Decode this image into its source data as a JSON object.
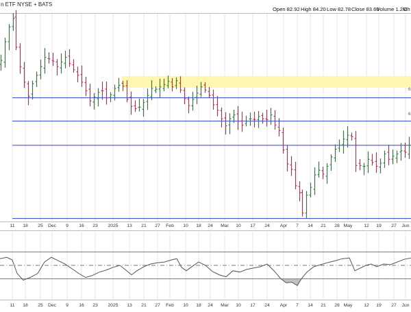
{
  "header": {
    "symbol_fragment": "n ETF  NYSE + BATS",
    "open": "Open 82.92",
    "high": "High 84.20",
    "low": "Low 82.78",
    "close": "Close 83.60",
    "volume": "Volume 1.2M",
    "overflow_fragment": "Ch"
  },
  "right_edge_labels": [
    "6",
    "6"
  ],
  "colors": {
    "up": "#1a8a2e",
    "down": "#d81b60",
    "hline": "#2b43c9",
    "zone": "#fff6b0",
    "indicator": "#555555",
    "grid": "#e4e4e4"
  },
  "chart_data": [
    {
      "type": "ohlc",
      "title": "",
      "x_tick_labels": [
        "11",
        "18",
        "25",
        "Dec",
        "9",
        "16",
        "23",
        "2025",
        "13",
        "21",
        "27",
        "Feb",
        "10",
        "18",
        "24",
        "Mar",
        "10",
        "17",
        "24",
        "Apr",
        "7",
        "14",
        "21",
        "28",
        "May",
        "12",
        "19",
        "27",
        "Jun"
      ],
      "horizontal_lines": [
        94.0,
        91.0,
        87.9,
        78.5
      ],
      "resistance_zone": [
        95.3,
        96.8
      ],
      "price_series": [
        {
          "x": 0,
          "close": 98.8
        },
        {
          "x": 6,
          "close": 101.2
        },
        {
          "x": 12,
          "close": 103.1
        },
        {
          "x": 18,
          "close": 104.2
        },
        {
          "x": 22,
          "close": 100.5
        },
        {
          "x": 28,
          "close": 98.0
        },
        {
          "x": 34,
          "close": 96.0
        },
        {
          "x": 40,
          "close": 94.2
        },
        {
          "x": 46,
          "close": 95.8
        },
        {
          "x": 52,
          "close": 96.9
        },
        {
          "x": 58,
          "close": 98.0
        },
        {
          "x": 64,
          "close": 99.2
        },
        {
          "x": 70,
          "close": 99.0
        },
        {
          "x": 76,
          "close": 98.7
        },
        {
          "x": 82,
          "close": 98.0
        },
        {
          "x": 88,
          "close": 98.6
        },
        {
          "x": 94,
          "close": 99.2
        },
        {
          "x": 100,
          "close": 98.4
        },
        {
          "x": 106,
          "close": 97.6
        },
        {
          "x": 112,
          "close": 96.9
        },
        {
          "x": 118,
          "close": 96.0
        },
        {
          "x": 124,
          "close": 94.9
        },
        {
          "x": 130,
          "close": 93.6
        },
        {
          "x": 136,
          "close": 94.1
        },
        {
          "x": 142,
          "close": 94.7
        },
        {
          "x": 148,
          "close": 94.9
        },
        {
          "x": 154,
          "close": 94.0
        },
        {
          "x": 160,
          "close": 94.4
        },
        {
          "x": 166,
          "close": 95.2
        },
        {
          "x": 172,
          "close": 95.6
        },
        {
          "x": 178,
          "close": 95.5
        },
        {
          "x": 184,
          "close": 93.8
        },
        {
          "x": 190,
          "close": 92.9
        },
        {
          "x": 196,
          "close": 92.6
        },
        {
          "x": 202,
          "close": 92.8
        },
        {
          "x": 208,
          "close": 93.4
        },
        {
          "x": 214,
          "close": 94.3
        },
        {
          "x": 220,
          "close": 95.2
        },
        {
          "x": 226,
          "close": 95.1
        },
        {
          "x": 232,
          "close": 95.4
        },
        {
          "x": 238,
          "close": 95.7
        },
        {
          "x": 244,
          "close": 96.1
        },
        {
          "x": 250,
          "close": 95.4
        },
        {
          "x": 256,
          "close": 96.2
        },
        {
          "x": 262,
          "close": 95.0
        },
        {
          "x": 268,
          "close": 93.9
        },
        {
          "x": 274,
          "close": 93.0
        },
        {
          "x": 280,
          "close": 93.8
        },
        {
          "x": 286,
          "close": 94.6
        },
        {
          "x": 292,
          "close": 95.4
        },
        {
          "x": 298,
          "close": 95.0
        },
        {
          "x": 304,
          "close": 94.3
        },
        {
          "x": 310,
          "close": 93.1
        },
        {
          "x": 316,
          "close": 92.4
        },
        {
          "x": 322,
          "close": 91.3
        },
        {
          "x": 328,
          "close": 90.4
        },
        {
          "x": 334,
          "close": 91.3
        },
        {
          "x": 340,
          "close": 91.8
        },
        {
          "x": 346,
          "close": 91.0
        },
        {
          "x": 352,
          "close": 90.5
        },
        {
          "x": 358,
          "close": 91.0
        },
        {
          "x": 364,
          "close": 91.3
        },
        {
          "x": 370,
          "close": 91.2
        },
        {
          "x": 376,
          "close": 91.6
        },
        {
          "x": 382,
          "close": 91.3
        },
        {
          "x": 388,
          "close": 91.2
        },
        {
          "x": 394,
          "close": 91.8
        },
        {
          "x": 400,
          "close": 90.5
        },
        {
          "x": 406,
          "close": 89.8
        },
        {
          "x": 412,
          "close": 87.3
        },
        {
          "x": 418,
          "close": 85.5
        },
        {
          "x": 424,
          "close": 84.8
        },
        {
          "x": 430,
          "close": 82.7
        },
        {
          "x": 436,
          "close": 81.8
        },
        {
          "x": 440,
          "close": 79.2
        },
        {
          "x": 446,
          "close": 81.5
        },
        {
          "x": 452,
          "close": 82.5
        },
        {
          "x": 458,
          "close": 84.1
        },
        {
          "x": 464,
          "close": 84.7
        },
        {
          "x": 470,
          "close": 84.2
        },
        {
          "x": 476,
          "close": 85.2
        },
        {
          "x": 482,
          "close": 86.4
        },
        {
          "x": 488,
          "close": 87.4
        },
        {
          "x": 494,
          "close": 87.9
        },
        {
          "x": 500,
          "close": 88.7
        },
        {
          "x": 506,
          "close": 89.2
        },
        {
          "x": 512,
          "close": 89.0
        },
        {
          "x": 518,
          "close": 85.3
        },
        {
          "x": 524,
          "close": 85.3
        },
        {
          "x": 530,
          "close": 85.2
        },
        {
          "x": 536,
          "close": 86.1
        },
        {
          "x": 542,
          "close": 85.7
        },
        {
          "x": 548,
          "close": 85.2
        },
        {
          "x": 554,
          "close": 85.6
        },
        {
          "x": 560,
          "close": 86.8
        },
        {
          "x": 566,
          "close": 86.1
        },
        {
          "x": 572,
          "close": 86.5
        },
        {
          "x": 578,
          "close": 86.8
        },
        {
          "x": 584,
          "close": 87.2
        },
        {
          "x": 590,
          "close": 87.0
        },
        {
          "x": 596,
          "close": 87.9
        }
      ]
    },
    {
      "type": "line",
      "title": "",
      "reference_levels": [
        70,
        50,
        30
      ],
      "series": [
        {
          "x": 0,
          "y": 60
        },
        {
          "x": 10,
          "y": 62
        },
        {
          "x": 18,
          "y": 58
        },
        {
          "x": 25,
          "y": 38
        },
        {
          "x": 34,
          "y": 28
        },
        {
          "x": 44,
          "y": 32
        },
        {
          "x": 55,
          "y": 38
        },
        {
          "x": 65,
          "y": 55
        },
        {
          "x": 75,
          "y": 62
        },
        {
          "x": 85,
          "y": 57
        },
        {
          "x": 95,
          "y": 52
        },
        {
          "x": 105,
          "y": 45
        },
        {
          "x": 115,
          "y": 38
        },
        {
          "x": 125,
          "y": 32
        },
        {
          "x": 135,
          "y": 35
        },
        {
          "x": 145,
          "y": 40
        },
        {
          "x": 155,
          "y": 43
        },
        {
          "x": 165,
          "y": 47
        },
        {
          "x": 175,
          "y": 50
        },
        {
          "x": 185,
          "y": 42
        },
        {
          "x": 192,
          "y": 36
        },
        {
          "x": 200,
          "y": 42
        },
        {
          "x": 210,
          "y": 48
        },
        {
          "x": 220,
          "y": 52
        },
        {
          "x": 230,
          "y": 54
        },
        {
          "x": 240,
          "y": 55
        },
        {
          "x": 250,
          "y": 58
        },
        {
          "x": 258,
          "y": 60
        },
        {
          "x": 265,
          "y": 47
        },
        {
          "x": 272,
          "y": 42
        },
        {
          "x": 280,
          "y": 48
        },
        {
          "x": 290,
          "y": 55
        },
        {
          "x": 300,
          "y": 50
        },
        {
          "x": 310,
          "y": 41
        },
        {
          "x": 320,
          "y": 36
        },
        {
          "x": 330,
          "y": 33
        },
        {
          "x": 340,
          "y": 42
        },
        {
          "x": 350,
          "y": 40
        },
        {
          "x": 360,
          "y": 44
        },
        {
          "x": 370,
          "y": 46
        },
        {
          "x": 380,
          "y": 48
        },
        {
          "x": 390,
          "y": 52
        },
        {
          "x": 400,
          "y": 42
        },
        {
          "x": 410,
          "y": 30
        },
        {
          "x": 418,
          "y": 24
        },
        {
          "x": 426,
          "y": 25
        },
        {
          "x": 434,
          "y": 20
        },
        {
          "x": 440,
          "y": 30
        },
        {
          "x": 448,
          "y": 40
        },
        {
          "x": 458,
          "y": 48
        },
        {
          "x": 468,
          "y": 51
        },
        {
          "x": 478,
          "y": 54
        },
        {
          "x": 490,
          "y": 57
        },
        {
          "x": 500,
          "y": 60
        },
        {
          "x": 510,
          "y": 61
        },
        {
          "x": 518,
          "y": 42
        },
        {
          "x": 526,
          "y": 46
        },
        {
          "x": 534,
          "y": 50
        },
        {
          "x": 542,
          "y": 52
        },
        {
          "x": 550,
          "y": 48
        },
        {
          "x": 560,
          "y": 52
        },
        {
          "x": 570,
          "y": 51
        },
        {
          "x": 580,
          "y": 55
        },
        {
          "x": 590,
          "y": 59
        },
        {
          "x": 600,
          "y": 61
        }
      ]
    }
  ]
}
